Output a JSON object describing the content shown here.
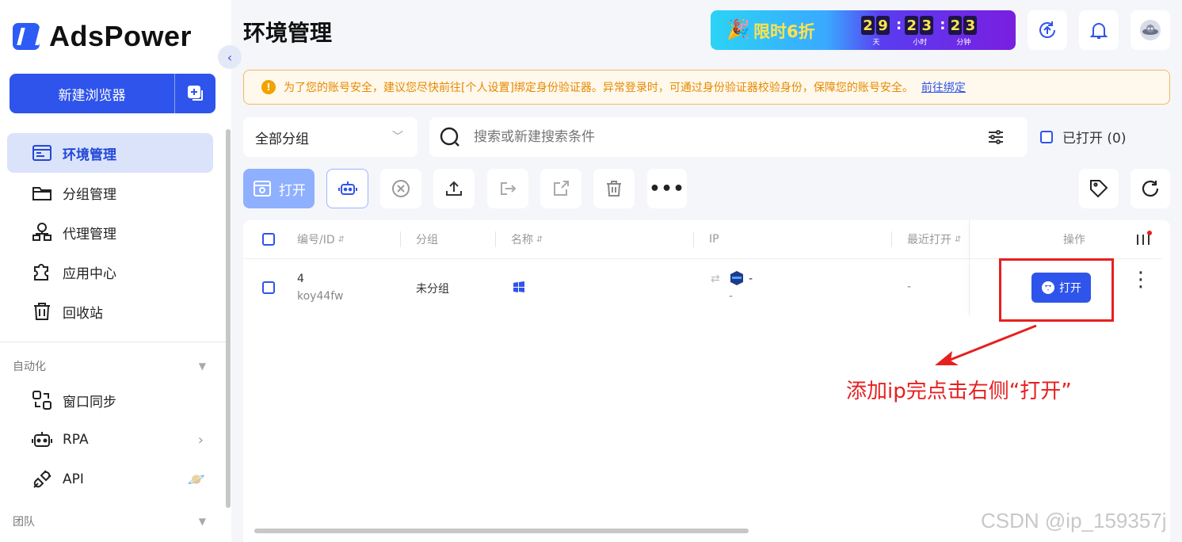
{
  "brand": {
    "name": "AdsPower",
    "accent": "#2f54eb"
  },
  "sidebar": {
    "new_browser_label": "新建浏览器",
    "items": [
      {
        "label": "环境管理",
        "icon": "browser-window-icon",
        "active": true
      },
      {
        "label": "分组管理",
        "icon": "folder-icon"
      },
      {
        "label": "代理管理",
        "icon": "network-icon"
      },
      {
        "label": "应用中心",
        "icon": "puzzle-icon"
      },
      {
        "label": "回收站",
        "icon": "trash-icon"
      }
    ],
    "section_automation": "自动化",
    "automation_items": [
      {
        "label": "窗口同步",
        "icon": "sync-icon"
      },
      {
        "label": "RPA",
        "icon": "robot-icon"
      },
      {
        "label": "API",
        "icon": "plug-icon"
      }
    ],
    "section_team": "团队"
  },
  "header": {
    "title": "环境管理",
    "promo": {
      "text": "限时6折",
      "days": [
        "2",
        "9"
      ],
      "hours": [
        "2",
        "3"
      ],
      "minutes": [
        "2",
        "3"
      ],
      "label_days": "天",
      "label_hours": "小时",
      "label_minutes": "分钟"
    }
  },
  "banner": {
    "text": "为了您的账号安全，建议您尽快前往[个人设置]绑定身份验证器。异常登录时，可通过身份验证器校验身份，保障您的账号安全。",
    "link": "前往绑定"
  },
  "filters": {
    "group": "全部分组",
    "search_placeholder": "搜索或新建搜索条件",
    "opened_label": "已打开 (0)"
  },
  "toolbar": {
    "open_label": "打开"
  },
  "table": {
    "columns": [
      "编号/ID",
      "分组",
      "名称",
      "IP",
      "最近打开",
      "操作"
    ],
    "rows": [
      {
        "num": "4",
        "id": "koy44fw",
        "group": "未分组",
        "ip": "-",
        "ip_sub": "-",
        "last_open": "-",
        "action": "打开"
      }
    ]
  },
  "annotation": "添加ip完点击右侧“打开”",
  "watermark": "CSDN @ip_159357j"
}
